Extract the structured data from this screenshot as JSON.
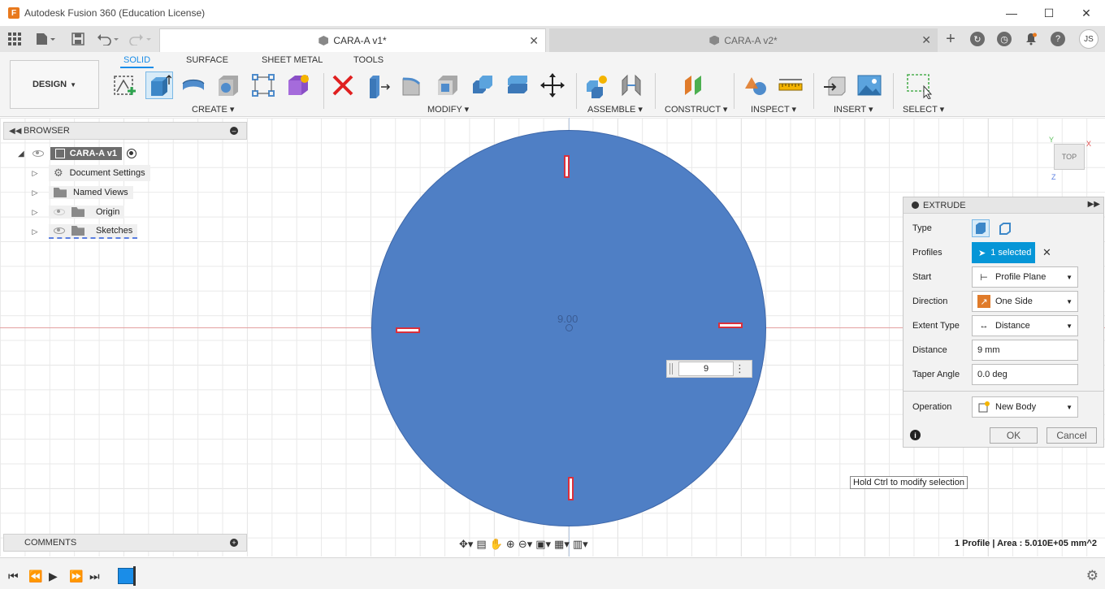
{
  "window": {
    "title": "Autodesk Fusion 360 (Education License)",
    "minimize": "—",
    "maximize": "☐",
    "close": "✕"
  },
  "tabs": [
    {
      "label": "CARA-A v1*",
      "active": true
    },
    {
      "label": "CARA-A v2*",
      "active": false
    }
  ],
  "user_initials": "JS",
  "toolbar": {
    "workspace": "DESIGN",
    "tabs": [
      "SOLID",
      "SURFACE",
      "SHEET METAL",
      "TOOLS"
    ],
    "groups": [
      "CREATE",
      "MODIFY",
      "ASSEMBLE",
      "CONSTRUCT",
      "INSPECT",
      "INSERT",
      "SELECT"
    ]
  },
  "browser": {
    "title": "BROWSER",
    "root": "CARA-A v1",
    "items": [
      "Document Settings",
      "Named Views",
      "Origin",
      "Sketches"
    ]
  },
  "canvas": {
    "dimension_label": "9.00",
    "value_input": "9",
    "tooltip": "Hold Ctrl to modify selection",
    "viewcube": "TOP"
  },
  "extrude": {
    "title": "EXTRUDE",
    "rows": {
      "type": "Type",
      "profiles": "Profiles",
      "profiles_value": "1 selected",
      "start": "Start",
      "start_value": "Profile Plane",
      "direction": "Direction",
      "direction_value": "One Side",
      "extent_type": "Extent Type",
      "extent_value": "Distance",
      "distance": "Distance",
      "distance_value": "9 mm",
      "taper": "Taper Angle",
      "taper_value": "0.0 deg",
      "operation": "Operation",
      "operation_value": "New Body"
    },
    "ok": "OK",
    "cancel": "Cancel"
  },
  "comments": "COMMENTS",
  "status": "1 Profile | Area : 5.010E+05 mm^2",
  "colors": {
    "accent": "#0696d7",
    "body": "#4f7fc5",
    "slot_border": "#d9303c"
  }
}
